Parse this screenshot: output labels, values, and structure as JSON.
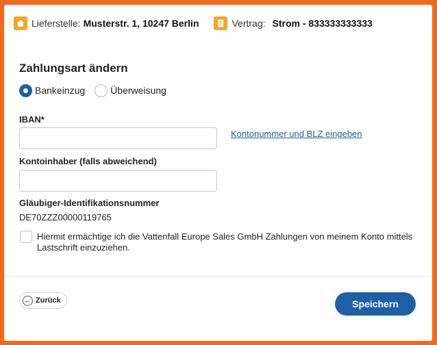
{
  "header": {
    "delivery_label": "Lieferstelle:",
    "delivery_value": "Musterstr. 1, 10247 Berlin",
    "contract_label": "Vertrag:",
    "contract_value": "Strom - 833333333333",
    "delivery_icon": "house-icon",
    "contract_icon": "document-icon"
  },
  "form": {
    "title": "Zahlungsart ändern",
    "payment_options": [
      {
        "label": "Bankeinzug",
        "checked": true
      },
      {
        "label": "Überweisung",
        "checked": false
      }
    ],
    "iban_label": "IBAN*",
    "iban_value": "",
    "account_link": "Kontonummer und BLZ eingeben",
    "holder_label": "Kontoinhaber (falls abweichend)",
    "holder_value": "",
    "creditor_id_label": "Gläubiger-Identifikationsnummer",
    "creditor_id_value": "DE70ZZZ00000119765",
    "consent_checked": false,
    "consent_text": "Hiermit ermächtige ich die Vattenfall Europe Sales GmbH Zahlungen von meinem Konto mittels Lastschrift einzuziehen."
  },
  "footer": {
    "back_label": "Zurück",
    "save_label": "Speichern"
  },
  "colors": {
    "accent": "#1f5fa6",
    "border": "#ef6a1d",
    "header_icon": "#f5a623"
  }
}
